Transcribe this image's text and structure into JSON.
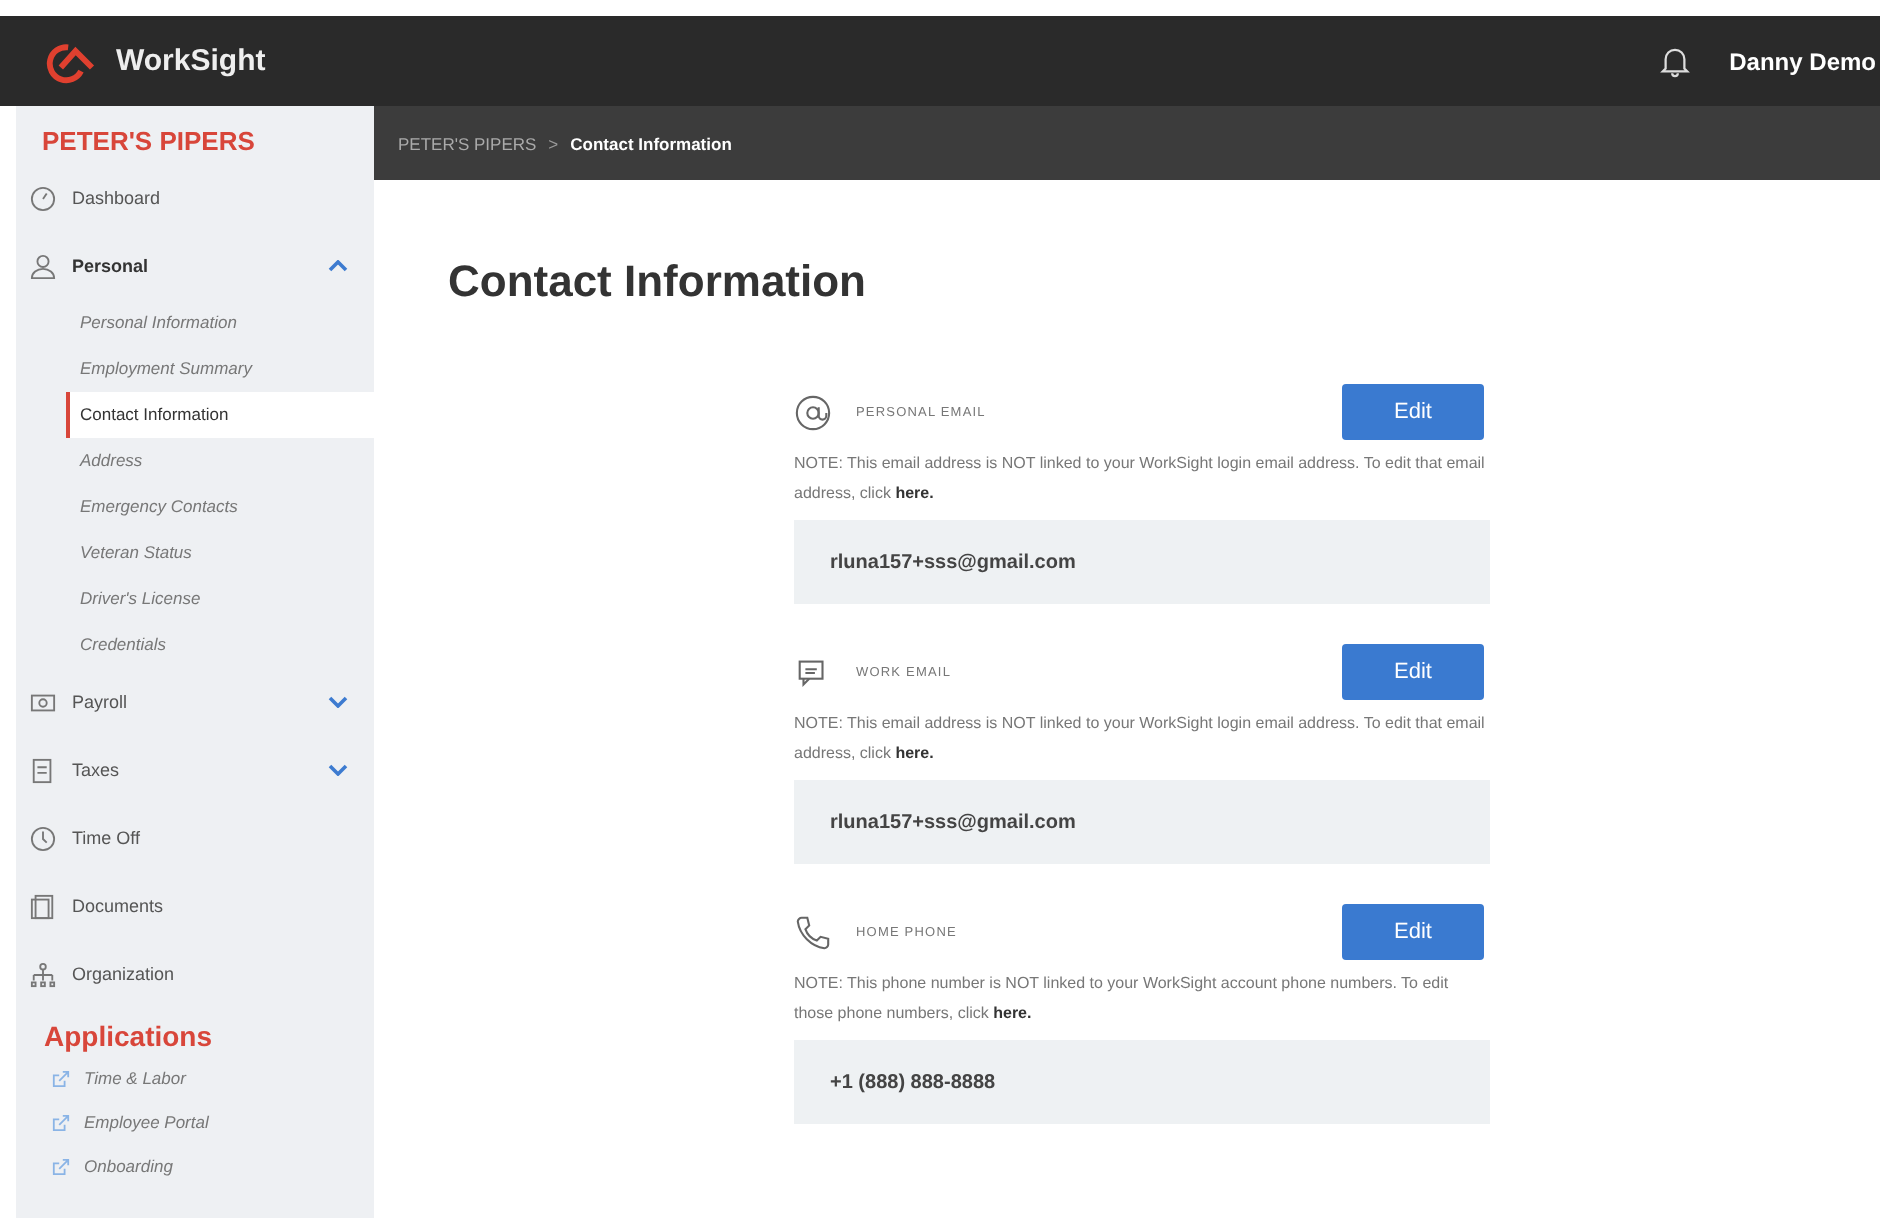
{
  "header": {
    "brand": "WorkSight",
    "user": "Danny Demo"
  },
  "sidebar": {
    "company": "PETER'S PIPERS",
    "nav": [
      {
        "kind": "item",
        "label": "Dashboard"
      },
      {
        "kind": "group",
        "label": "Personal",
        "expanded": true,
        "children": [
          {
            "label": "Personal Information",
            "selected": false
          },
          {
            "label": "Employment Summary",
            "selected": false
          },
          {
            "label": "Contact Information",
            "selected": true
          },
          {
            "label": "Address",
            "selected": false
          },
          {
            "label": "Emergency Contacts",
            "selected": false
          },
          {
            "label": "Veteran Status",
            "selected": false
          },
          {
            "label": "Driver's License",
            "selected": false
          },
          {
            "label": "Credentials",
            "selected": false
          }
        ]
      },
      {
        "kind": "group",
        "label": "Payroll",
        "expanded": false
      },
      {
        "kind": "group",
        "label": "Taxes",
        "expanded": false
      },
      {
        "kind": "item",
        "label": "Time Off"
      },
      {
        "kind": "item",
        "label": "Documents"
      },
      {
        "kind": "item",
        "label": "Organization"
      }
    ],
    "applications_title": "Applications",
    "applications": [
      "Time & Labor",
      "Employee Portal",
      "Onboarding"
    ]
  },
  "breadcrumb": {
    "parent": "PETER'S PIPERS",
    "separator": ">",
    "current": "Contact Information"
  },
  "page_title": "Contact Information",
  "sections": [
    {
      "kind": "email",
      "label": "PERSONAL EMAIL",
      "button": "Edit",
      "note": "NOTE: This email address is NOT linked to your WorkSight login email address. To edit that email address, click ",
      "link": "here.",
      "value": "rluna157+sss@gmail.com"
    },
    {
      "kind": "work",
      "label": "WORK EMAIL",
      "button": "Edit",
      "note": "NOTE: This email address is NOT linked to your WorkSight login email address. To edit that email address, click ",
      "link": "here.",
      "value": "rluna157+sss@gmail.com"
    },
    {
      "kind": "phone",
      "label": "HOME PHONE",
      "button": "Edit",
      "note": "NOTE: This phone number is NOT linked to your WorkSight account phone numbers. To edit those phone numbers, click ",
      "link": "here.",
      "value": "+1 (888) 888-8888"
    }
  ]
}
